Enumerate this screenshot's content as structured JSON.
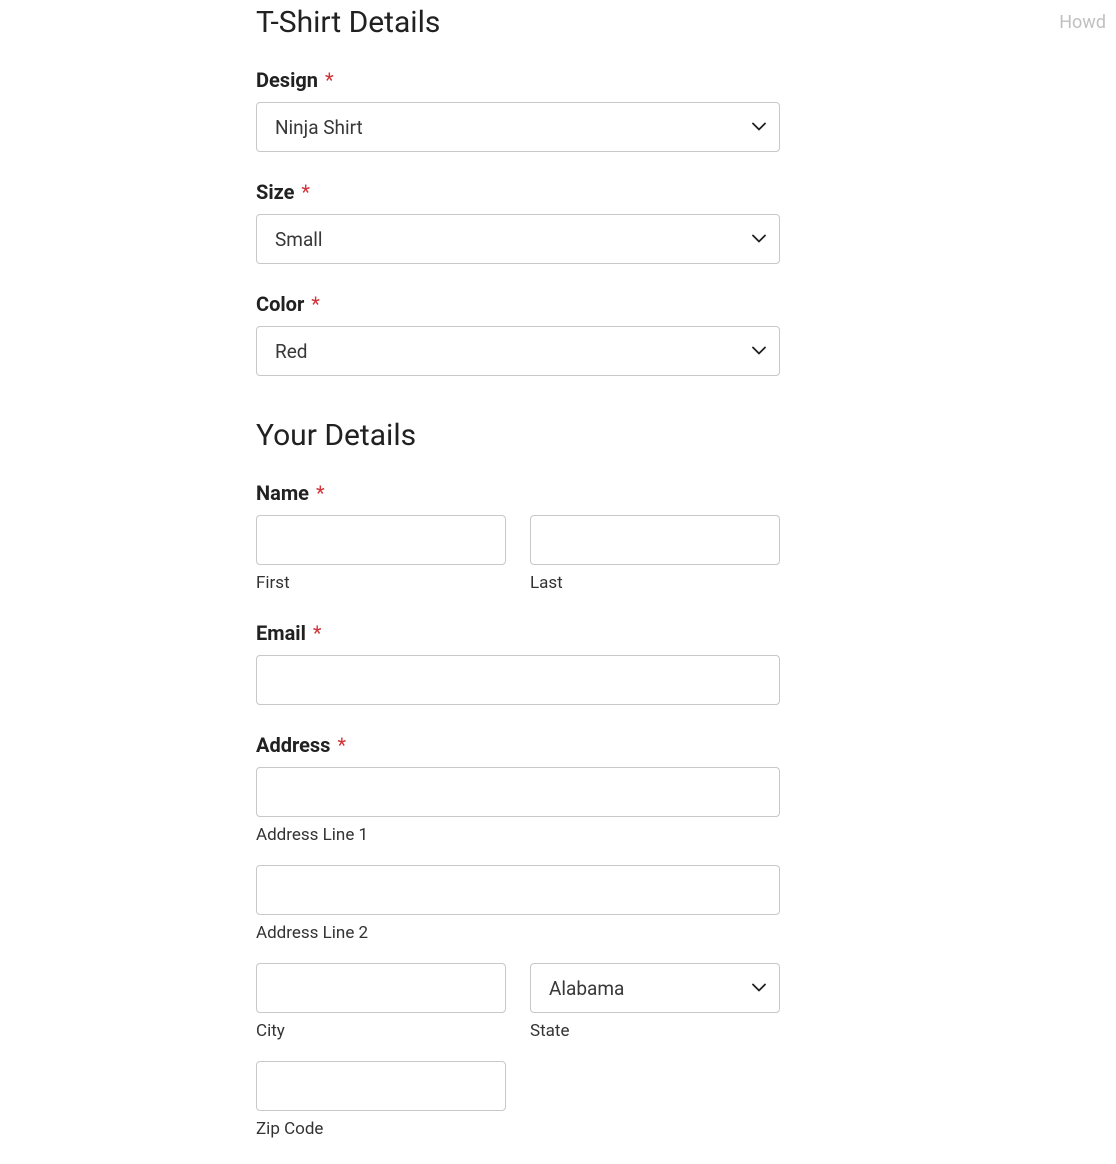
{
  "corner_text": "Howd",
  "sections": {
    "tshirt": {
      "title": "T-Shirt Details",
      "design": {
        "label": "Design",
        "required": "*",
        "value": "Ninja Shirt"
      },
      "size": {
        "label": "Size",
        "required": "*",
        "value": "Small"
      },
      "color": {
        "label": "Color",
        "required": "*",
        "value": "Red"
      }
    },
    "your": {
      "title": "Your Details",
      "name": {
        "label": "Name",
        "required": "*",
        "first_sub": "First",
        "last_sub": "Last"
      },
      "email": {
        "label": "Email",
        "required": "*"
      },
      "address": {
        "label": "Address",
        "required": "*",
        "line1_sub": "Address Line 1",
        "line2_sub": "Address Line 2",
        "city_sub": "City",
        "state_sub": "State",
        "state_value": "Alabama",
        "zip_sub": "Zip Code"
      }
    }
  }
}
